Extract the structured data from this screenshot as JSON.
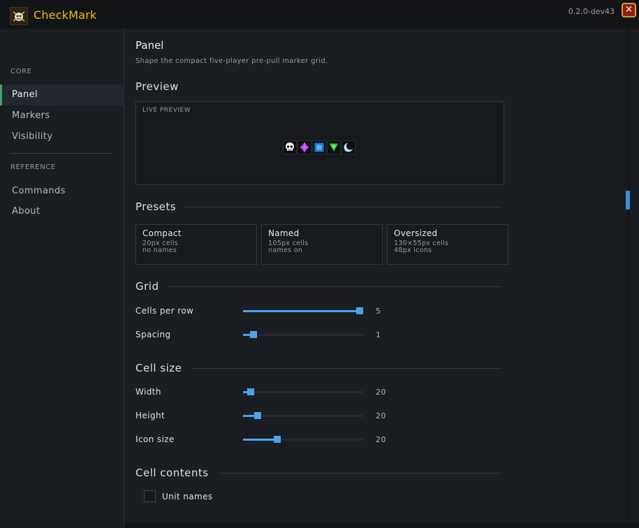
{
  "window": {
    "app_title": "CheckMark",
    "version": "0.2.0-dev43",
    "close_glyph": "✕"
  },
  "sidebar": {
    "sections": [
      {
        "header": "CORE",
        "items": [
          {
            "label": "Panel",
            "active": true
          },
          {
            "label": "Markers",
            "active": false
          },
          {
            "label": "Visibility",
            "active": false
          }
        ]
      },
      {
        "header": "REFERENCE",
        "items": [
          {
            "label": "Commands",
            "active": false
          },
          {
            "label": "About",
            "active": false
          }
        ]
      }
    ]
  },
  "page": {
    "title": "Panel",
    "description": "Shape the compact five-player pre-pull marker grid."
  },
  "preview": {
    "section_title": "Preview",
    "label": "LIVE PREVIEW",
    "markers": [
      "skull-icon",
      "diamond-icon",
      "square-icon",
      "triangle-icon",
      "moon-icon"
    ]
  },
  "presets": {
    "section_title": "Presets",
    "cards": [
      {
        "name": "Compact",
        "line1": "20px cells",
        "line2": "no names"
      },
      {
        "name": "Named",
        "line1": "105px cells",
        "line2": "names on"
      },
      {
        "name": "Oversized",
        "line1": "130×55px cells",
        "line2": "48px icons"
      }
    ]
  },
  "grid": {
    "section_title": "Grid",
    "sliders": [
      {
        "label": "Cells per row",
        "value": "5",
        "fraction": 1.0
      },
      {
        "label": "Spacing",
        "value": "1",
        "fraction": 0.06
      }
    ]
  },
  "cell_size": {
    "section_title": "Cell size",
    "sliders": [
      {
        "label": "Width",
        "value": "20",
        "fraction": 0.04
      },
      {
        "label": "Height",
        "value": "20",
        "fraction": 0.1
      },
      {
        "label": "Icon size",
        "value": "20",
        "fraction": 0.27
      }
    ]
  },
  "cell_contents": {
    "section_title": "Cell contents",
    "checkbox_label": "Unit names",
    "checked": false
  },
  "colors": {
    "accent": "#4da3ee",
    "active_indicator": "#3fa06a",
    "title_gold": "#f0c000"
  }
}
